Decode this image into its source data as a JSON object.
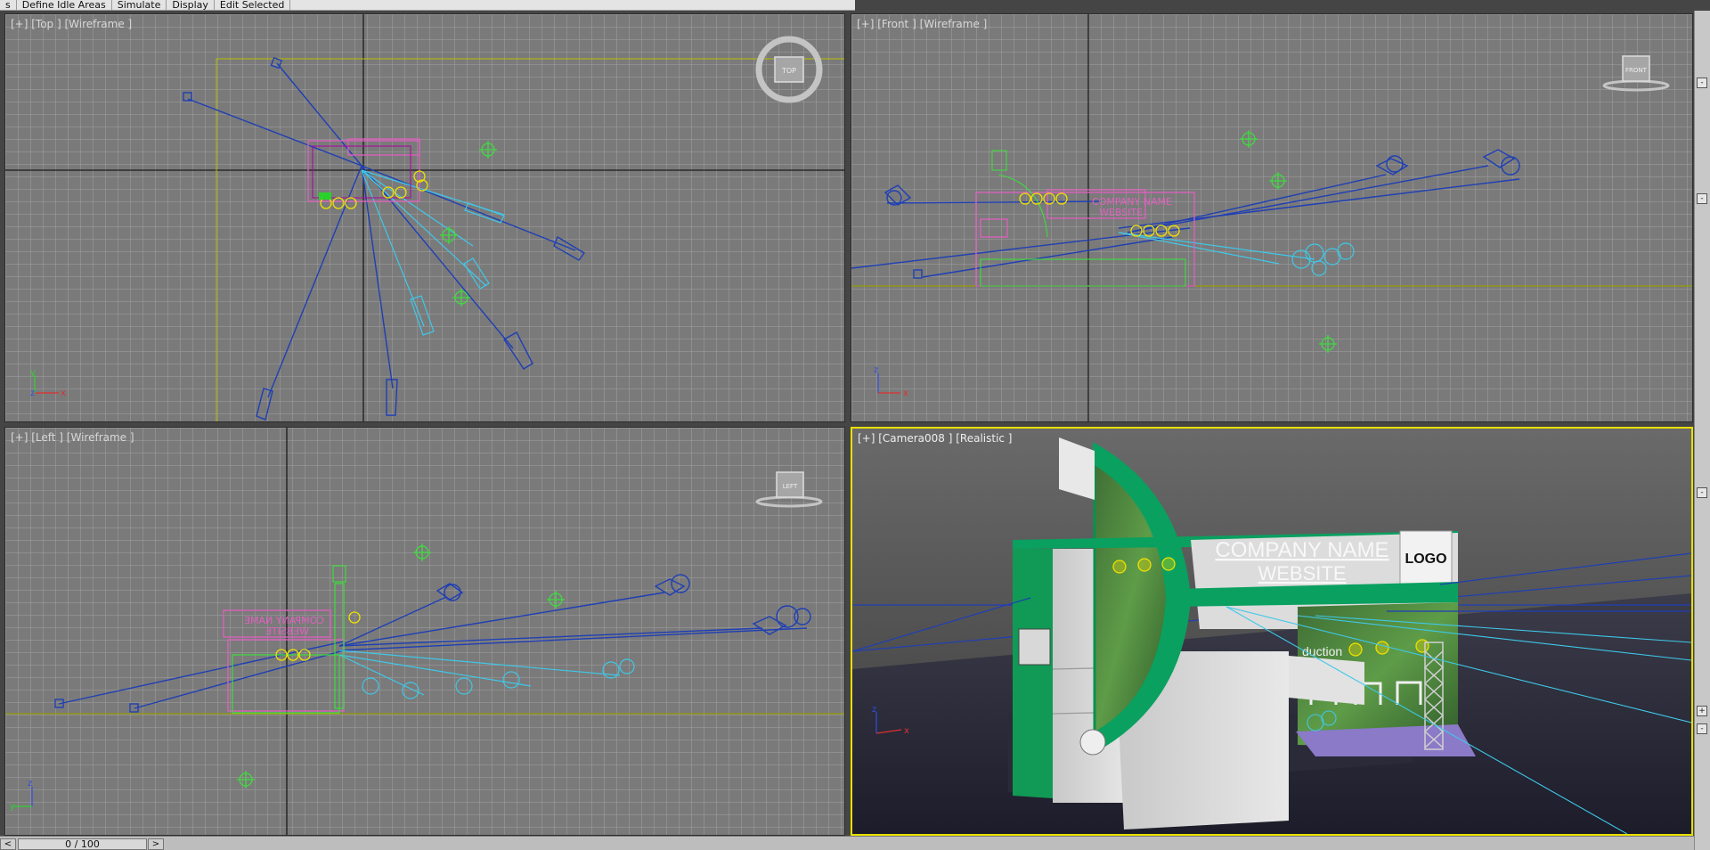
{
  "menu": {
    "items": [
      "s",
      "Define Idle Areas",
      "Simulate",
      "Display",
      "Edit Selected"
    ]
  },
  "viewports": {
    "top": {
      "label": "[+] [Top ] [Wireframe ]",
      "navcube": "TOP",
      "axes": [
        "y",
        "z",
        "x"
      ]
    },
    "front": {
      "label": "[+] [Front ] [Wireframe ]",
      "navcube": "FRONT",
      "axes": [
        "z",
        "x"
      ]
    },
    "left": {
      "label": "[+] [Left ] [Wireframe ]",
      "navcube": "LEFT",
      "axes": [
        "z",
        "y"
      ]
    },
    "camera": {
      "label": "[+] [Camera008 ] [Realistic ]",
      "company": "COMPANY NAME",
      "website": "WEBSITE",
      "logo": "LOGO",
      "wall_text": "duction",
      "wire_company": "COMPANY NAME",
      "wire_website": "WEBSITE",
      "axes": [
        "z",
        "x"
      ]
    }
  },
  "timeline": {
    "frame": "0 / 100",
    "prev": "<",
    "next": ">"
  },
  "colors": {
    "viewport_bg": "#7a7a7a",
    "active_border": "#e8e000",
    "wire_blue": "#1f3fb4",
    "wire_cyan": "#3fc8e8",
    "wire_yellow": "#f0e000",
    "wire_pink": "#e060c0",
    "helper_green": "#3fdc3f",
    "booth_green": "#0a9050"
  }
}
